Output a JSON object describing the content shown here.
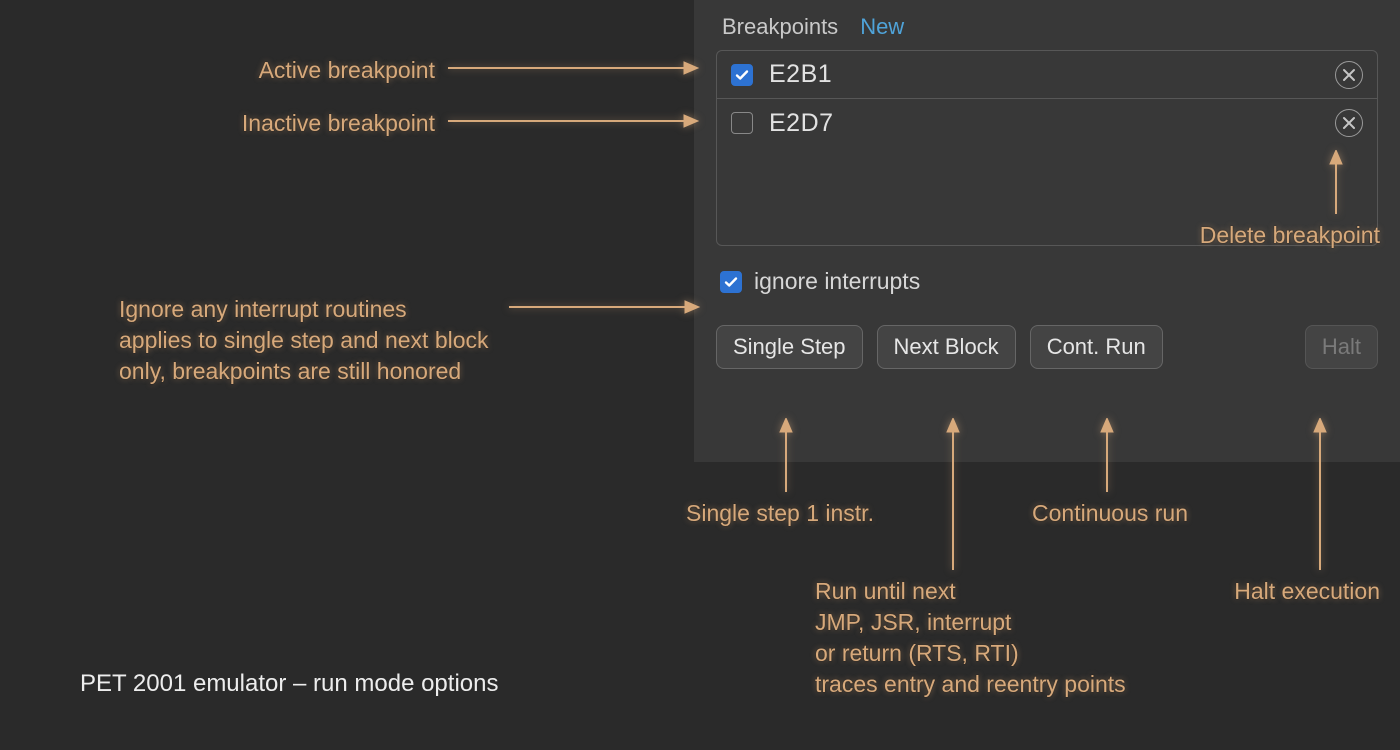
{
  "panel": {
    "tabs": {
      "breakpoints": "Breakpoints",
      "new": "New"
    },
    "breakpoints": [
      {
        "address": "E2B1",
        "checked": true
      },
      {
        "address": "E2D7",
        "checked": false
      }
    ],
    "ignore_label": "ignore interrupts",
    "ignore_checked": true,
    "buttons": {
      "single_step": "Single Step",
      "next_block": "Next Block",
      "cont_run": "Cont. Run",
      "halt": "Halt"
    }
  },
  "annotations": {
    "active_bp": "Active breakpoint",
    "inactive_bp": "Inactive breakpoint",
    "ignore_note": "Ignore any interrupt routines\napplies to single step and next block\nonly, breakpoints are still honored",
    "delete_bp": "Delete breakpoint",
    "single_step": "Single step 1 instr.",
    "next_block": "Run until next\nJMP, JSR, interrupt\nor return (RTS, RTI)\ntraces entry and reentry points",
    "cont_run": "Continuous run",
    "halt": "Halt execution"
  },
  "caption": "PET 2001 emulator – run mode options",
  "colors": {
    "annotation": "#d7a97b",
    "accent_blue": "#2d72d2",
    "link_blue": "#4fa3d9",
    "panel_bg": "#383838",
    "page_bg": "#2a2a2a"
  }
}
